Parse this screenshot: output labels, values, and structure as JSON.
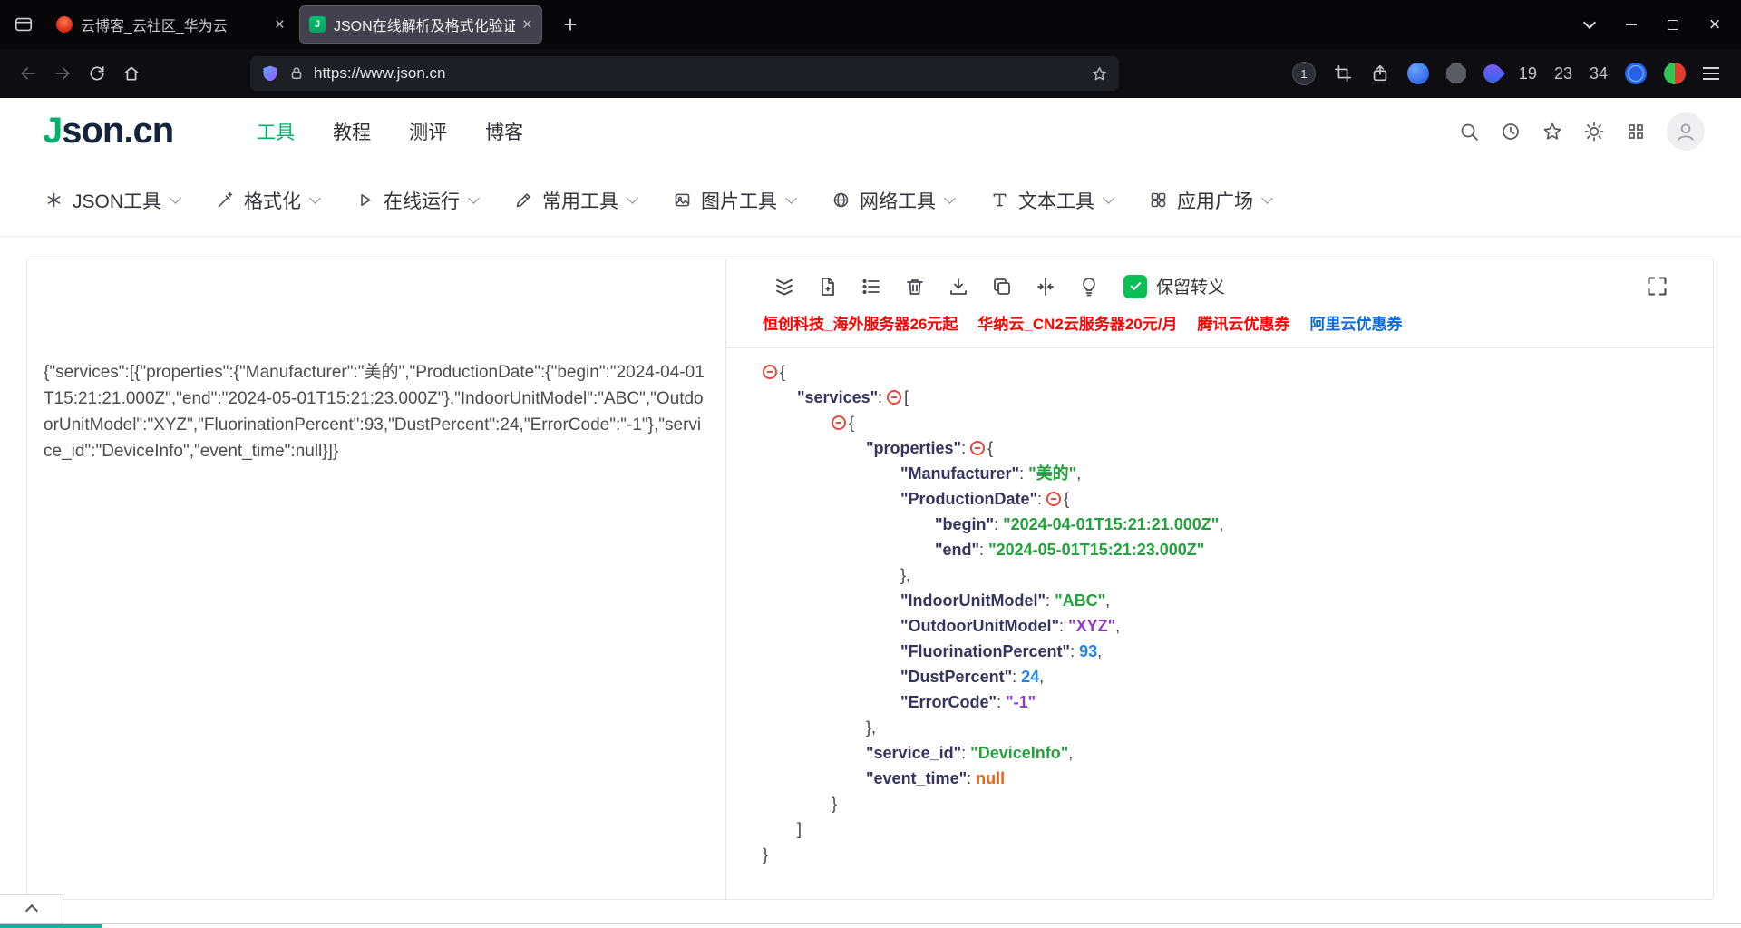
{
  "browser": {
    "tabs": [
      {
        "title": "云博客_云社区_华为云"
      },
      {
        "title": "JSON在线解析及格式化验证 -"
      }
    ],
    "url": "https://www.json.cn",
    "extension_badge": "1",
    "counters": [
      "19",
      "23",
      "34"
    ]
  },
  "header": {
    "logo_accent": "J",
    "logo_rest": "son.cn",
    "nav": [
      {
        "label": "工具"
      },
      {
        "label": "教程"
      },
      {
        "label": "测评"
      },
      {
        "label": "博客"
      }
    ]
  },
  "toolnav": {
    "items": [
      {
        "label": "JSON工具"
      },
      {
        "label": "格式化"
      },
      {
        "label": "在线运行"
      },
      {
        "label": "常用工具"
      },
      {
        "label": "图片工具"
      },
      {
        "label": "网络工具"
      },
      {
        "label": "文本工具"
      },
      {
        "label": "应用广场"
      }
    ]
  },
  "editor": {
    "raw_json": "{\"services\":[{\"properties\":{\"Manufacturer\":\"美的\",\"ProductionDate\":{\"begin\":\"2024-04-01T15:21:21.000Z\",\"end\":\"2024-05-01T15:21:23.000Z\"},\"IndoorUnitModel\":\"ABC\",\"OutdoorUnitModel\":\"XYZ\",\"FluorinationPercent\":93,\"DustPercent\":24,\"ErrorCode\":\"-1\"},\"service_id\":\"DeviceInfo\",\"event_time\":null}]}"
  },
  "result": {
    "keep_escape_label": "保留转义",
    "ads": [
      {
        "label": "恒创科技_海外服务器26元起",
        "color": "#fe0201"
      },
      {
        "label": "华纳云_CN2云服务器20元/月",
        "color": "#fe0201"
      },
      {
        "label": "腾讯云优惠券",
        "color": "#fe0201"
      },
      {
        "label": "阿里云优惠券",
        "color": "#0b6ada"
      }
    ],
    "tree": [
      {
        "indent": 0,
        "tokens": [
          {
            "c": "toggle"
          },
          {
            "c": "punc",
            "t": "{"
          }
        ]
      },
      {
        "indent": 1,
        "tokens": [
          {
            "c": "key",
            "t": "\"services\""
          },
          {
            "c": "punc",
            "t": ": "
          },
          {
            "c": "toggle"
          },
          {
            "c": "punc",
            "t": "["
          }
        ]
      },
      {
        "indent": 2,
        "tokens": [
          {
            "c": "toggle"
          },
          {
            "c": "punc",
            "t": "{"
          }
        ]
      },
      {
        "indent": 3,
        "tokens": [
          {
            "c": "key",
            "t": "\"properties\""
          },
          {
            "c": "punc",
            "t": ": "
          },
          {
            "c": "toggle"
          },
          {
            "c": "punc",
            "t": "{"
          }
        ]
      },
      {
        "indent": 4,
        "tokens": [
          {
            "c": "key",
            "t": "\"Manufacturer\""
          },
          {
            "c": "punc",
            "t": ": "
          },
          {
            "c": "str-green",
            "t": "\"美的\""
          },
          {
            "c": "punc",
            "t": ","
          }
        ]
      },
      {
        "indent": 4,
        "tokens": [
          {
            "c": "key",
            "t": "\"ProductionDate\""
          },
          {
            "c": "punc",
            "t": ": "
          },
          {
            "c": "toggle"
          },
          {
            "c": "punc",
            "t": "{"
          }
        ]
      },
      {
        "indent": 5,
        "tokens": [
          {
            "c": "key",
            "t": "\"begin\""
          },
          {
            "c": "punc",
            "t": ": "
          },
          {
            "c": "str-green",
            "t": "\"2024-04-01T15:21:21.000Z\""
          },
          {
            "c": "punc",
            "t": ","
          }
        ]
      },
      {
        "indent": 5,
        "tokens": [
          {
            "c": "key",
            "t": "\"end\""
          },
          {
            "c": "punc",
            "t": ": "
          },
          {
            "c": "str-green",
            "t": "\"2024-05-01T15:21:23.000Z\""
          }
        ]
      },
      {
        "indent": 4,
        "tokens": [
          {
            "c": "punc",
            "t": "},"
          }
        ]
      },
      {
        "indent": 4,
        "tokens": [
          {
            "c": "key",
            "t": "\"IndoorUnitModel\""
          },
          {
            "c": "punc",
            "t": ": "
          },
          {
            "c": "str-green",
            "t": "\"ABC\""
          },
          {
            "c": "punc",
            "t": ","
          }
        ]
      },
      {
        "indent": 4,
        "tokens": [
          {
            "c": "key",
            "t": "\"OutdoorUnitModel\""
          },
          {
            "c": "punc",
            "t": ": "
          },
          {
            "c": "str-purple",
            "t": "\"XYZ\""
          },
          {
            "c": "punc",
            "t": ","
          }
        ]
      },
      {
        "indent": 4,
        "tokens": [
          {
            "c": "key",
            "t": "\"FluorinationPercent\""
          },
          {
            "c": "punc",
            "t": ": "
          },
          {
            "c": "num",
            "t": "93"
          },
          {
            "c": "punc",
            "t": ","
          }
        ]
      },
      {
        "indent": 4,
        "tokens": [
          {
            "c": "key",
            "t": "\"DustPercent\""
          },
          {
            "c": "punc",
            "t": ": "
          },
          {
            "c": "num",
            "t": "24"
          },
          {
            "c": "punc",
            "t": ","
          }
        ]
      },
      {
        "indent": 4,
        "tokens": [
          {
            "c": "key",
            "t": "\"ErrorCode\""
          },
          {
            "c": "punc",
            "t": ": "
          },
          {
            "c": "str-purple",
            "t": "\"-1\""
          }
        ]
      },
      {
        "indent": 3,
        "tokens": [
          {
            "c": "punc",
            "t": "},"
          }
        ]
      },
      {
        "indent": 3,
        "tokens": [
          {
            "c": "key",
            "t": "\"service_id\""
          },
          {
            "c": "punc",
            "t": ": "
          },
          {
            "c": "str-green",
            "t": "\"DeviceInfo\""
          },
          {
            "c": "punc",
            "t": ","
          }
        ]
      },
      {
        "indent": 3,
        "tokens": [
          {
            "c": "key",
            "t": "\"event_time\""
          },
          {
            "c": "punc",
            "t": ": "
          },
          {
            "c": "null",
            "t": "null"
          }
        ]
      },
      {
        "indent": 2,
        "tokens": [
          {
            "c": "punc",
            "t": "}"
          }
        ]
      },
      {
        "indent": 1,
        "tokens": [
          {
            "c": "punc",
            "t": "]"
          }
        ]
      },
      {
        "indent": 0,
        "tokens": [
          {
            "c": "punc",
            "t": "}"
          }
        ]
      }
    ]
  },
  "colors": {
    "accent_green": "#00b26a",
    "key": "#34345f",
    "string_green": "#23a23c",
    "string_purple": "#9038c8",
    "number_blue": "#2585e8",
    "null_orange": "#e8641e",
    "toggle_red": "#e2483d",
    "checkbox_green": "#0abf53"
  }
}
